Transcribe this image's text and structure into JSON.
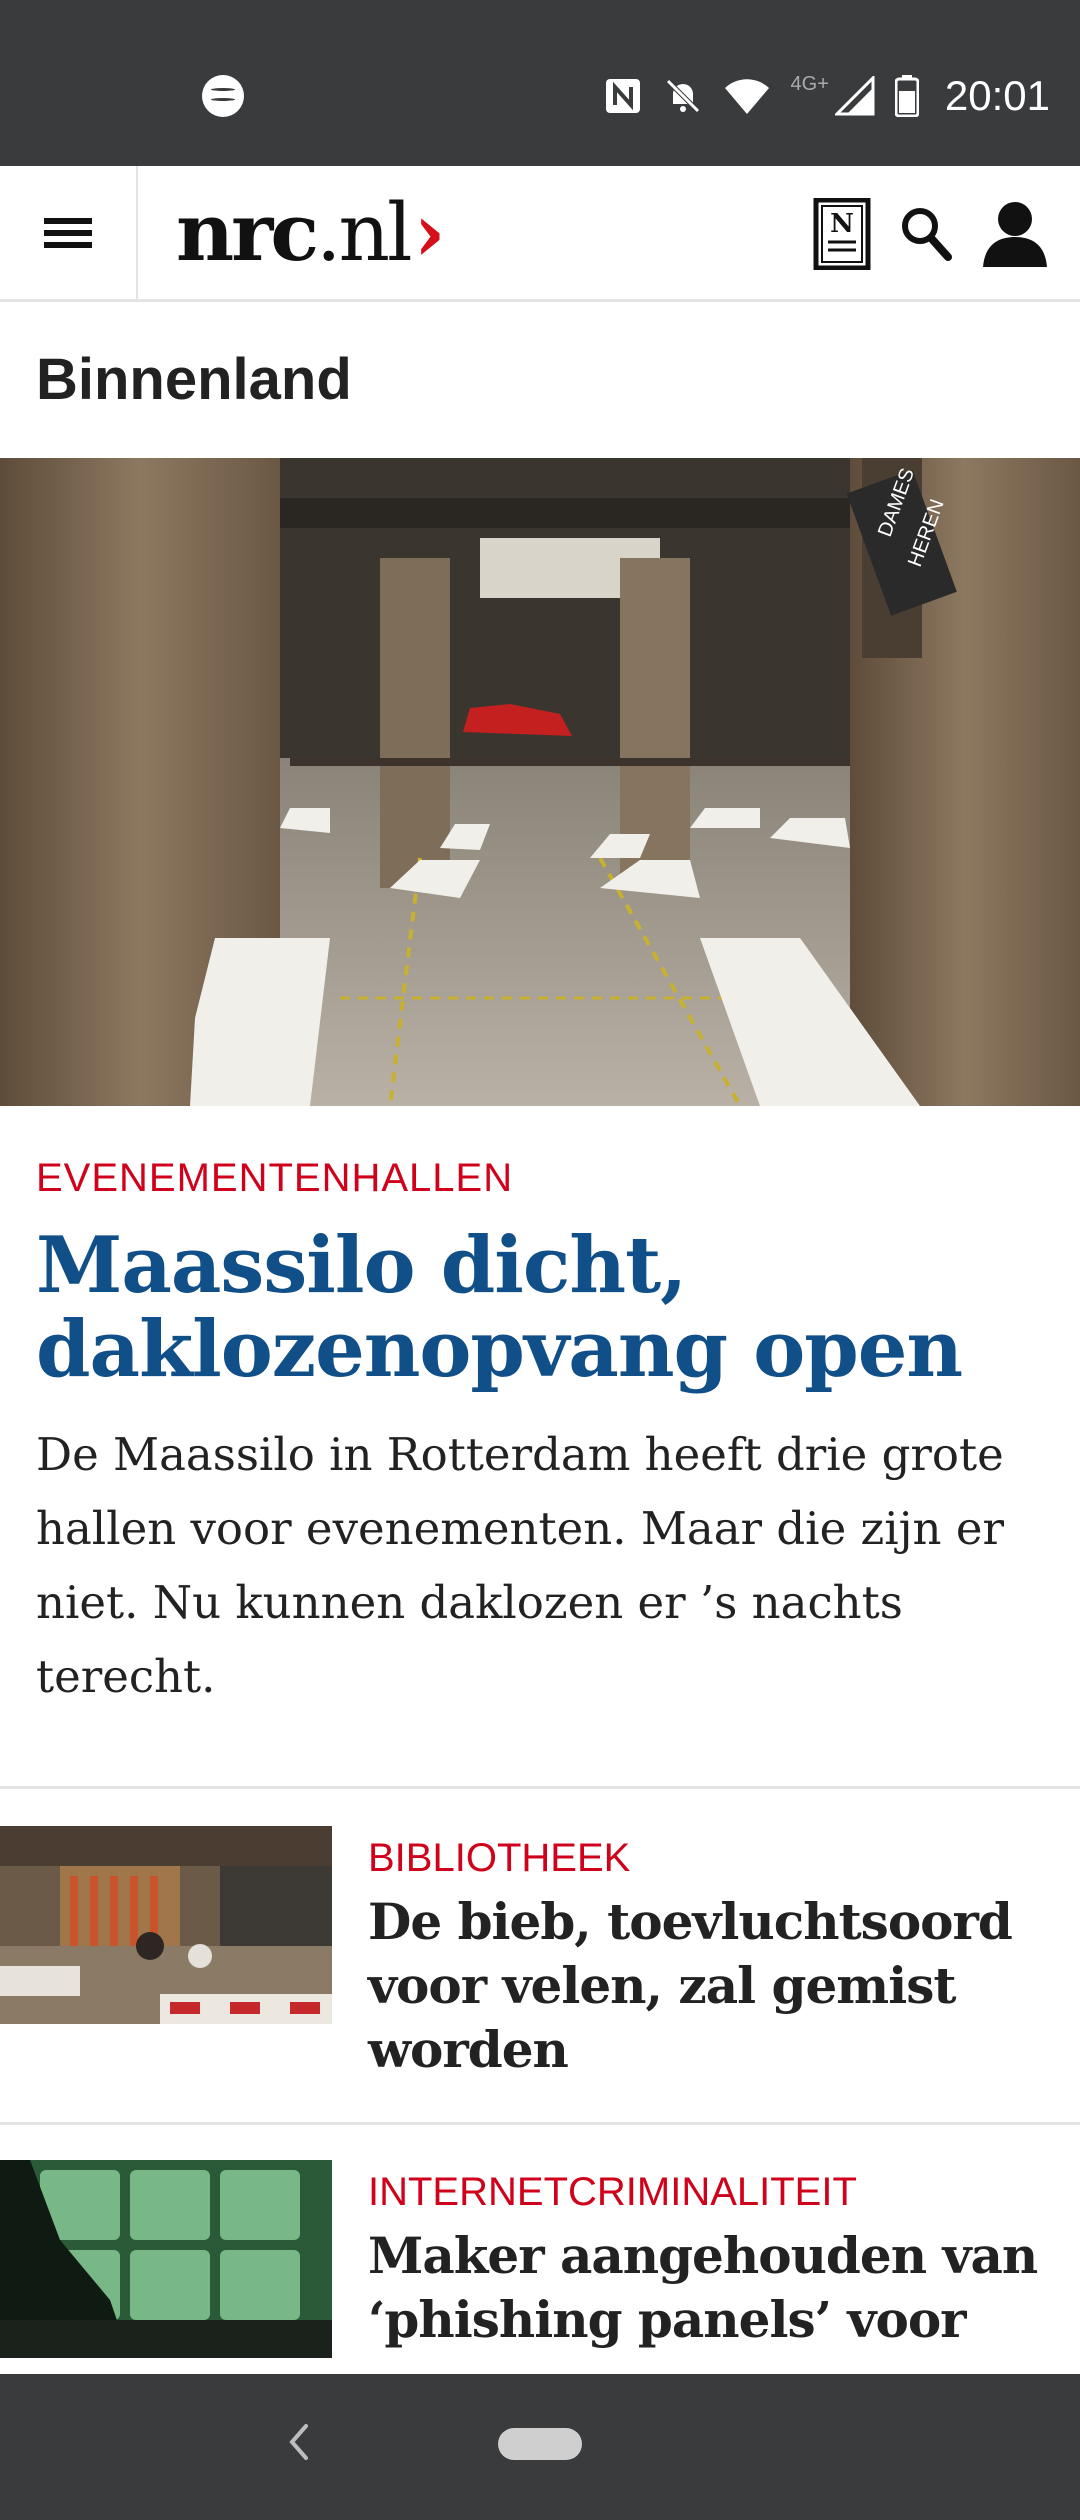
{
  "status_bar": {
    "time": "20:01",
    "network": "4G+",
    "icons": [
      "spotify-icon",
      "nfc-icon",
      "mute-icon",
      "wifi-icon",
      "signal-icon",
      "battery-icon"
    ]
  },
  "header": {
    "logo": {
      "name": "nrc",
      "dot": ".",
      "tld": "nl",
      "chevron": "›"
    },
    "icons": [
      "menu-icon",
      "newspaper-icon",
      "search-icon",
      "account-icon"
    ]
  },
  "section": {
    "title": "Binnenland"
  },
  "main_article": {
    "kicker": "EVENEMENTENHALLEN",
    "headline": "Maassilo dicht, daklozenopvang open",
    "lead": "De Maassilo in Rotterdam heeft drie grote hallen voor evenementen. Maar die zijn er niet. Nu kunnen daklozen er ’s nachts terecht.",
    "photo_sign": [
      "DAMES",
      "HEREN"
    ]
  },
  "articles": [
    {
      "kicker": "BIBLIOTHEEK",
      "headline": "De bieb, toevluchtsoord voor velen, zal gemist worden"
    },
    {
      "kicker": "INTERNETCRIMINALITEIT",
      "headline": "Maker aangehouden van ‘phishing panels’ voor"
    }
  ],
  "colors": {
    "accent_red": "#d0021b",
    "headline_blue": "#114f89",
    "system_bar": "#3a3b3d"
  }
}
